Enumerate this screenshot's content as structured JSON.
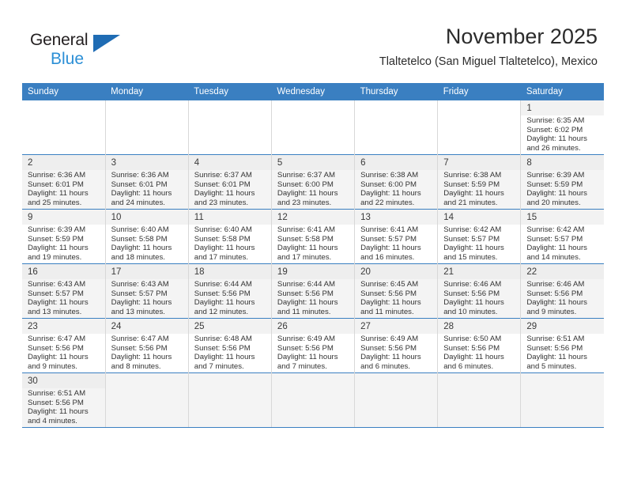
{
  "brand": {
    "name_top": "General",
    "name_bottom": "Blue",
    "triangle_icon": "triangle-icon",
    "accent_color": "#2b8fd6",
    "header_color": "#3a7fc1"
  },
  "header": {
    "title": "November 2025",
    "subtitle": "Tlaltetelco (San Miguel Tlaltetelco), Mexico"
  },
  "calendar": {
    "weekday_headers": [
      "Sunday",
      "Monday",
      "Tuesday",
      "Wednesday",
      "Thursday",
      "Friday",
      "Saturday"
    ],
    "labels": {
      "sunrise": "Sunrise:",
      "sunset": "Sunset:",
      "daylight": "Daylight:"
    },
    "weeks": [
      [
        {
          "day": ""
        },
        {
          "day": ""
        },
        {
          "day": ""
        },
        {
          "day": ""
        },
        {
          "day": ""
        },
        {
          "day": ""
        },
        {
          "day": "1",
          "sunrise": "Sunrise: 6:35 AM",
          "sunset": "Sunset: 6:02 PM",
          "daylight_line1": "Daylight: 11 hours",
          "daylight_line2": "and 26 minutes."
        }
      ],
      [
        {
          "day": "2",
          "sunrise": "Sunrise: 6:36 AM",
          "sunset": "Sunset: 6:01 PM",
          "daylight_line1": "Daylight: 11 hours",
          "daylight_line2": "and 25 minutes."
        },
        {
          "day": "3",
          "sunrise": "Sunrise: 6:36 AM",
          "sunset": "Sunset: 6:01 PM",
          "daylight_line1": "Daylight: 11 hours",
          "daylight_line2": "and 24 minutes."
        },
        {
          "day": "4",
          "sunrise": "Sunrise: 6:37 AM",
          "sunset": "Sunset: 6:01 PM",
          "daylight_line1": "Daylight: 11 hours",
          "daylight_line2": "and 23 minutes."
        },
        {
          "day": "5",
          "sunrise": "Sunrise: 6:37 AM",
          "sunset": "Sunset: 6:00 PM",
          "daylight_line1": "Daylight: 11 hours",
          "daylight_line2": "and 23 minutes."
        },
        {
          "day": "6",
          "sunrise": "Sunrise: 6:38 AM",
          "sunset": "Sunset: 6:00 PM",
          "daylight_line1": "Daylight: 11 hours",
          "daylight_line2": "and 22 minutes."
        },
        {
          "day": "7",
          "sunrise": "Sunrise: 6:38 AM",
          "sunset": "Sunset: 5:59 PM",
          "daylight_line1": "Daylight: 11 hours",
          "daylight_line2": "and 21 minutes."
        },
        {
          "day": "8",
          "sunrise": "Sunrise: 6:39 AM",
          "sunset": "Sunset: 5:59 PM",
          "daylight_line1": "Daylight: 11 hours",
          "daylight_line2": "and 20 minutes."
        }
      ],
      [
        {
          "day": "9",
          "sunrise": "Sunrise: 6:39 AM",
          "sunset": "Sunset: 5:59 PM",
          "daylight_line1": "Daylight: 11 hours",
          "daylight_line2": "and 19 minutes."
        },
        {
          "day": "10",
          "sunrise": "Sunrise: 6:40 AM",
          "sunset": "Sunset: 5:58 PM",
          "daylight_line1": "Daylight: 11 hours",
          "daylight_line2": "and 18 minutes."
        },
        {
          "day": "11",
          "sunrise": "Sunrise: 6:40 AM",
          "sunset": "Sunset: 5:58 PM",
          "daylight_line1": "Daylight: 11 hours",
          "daylight_line2": "and 17 minutes."
        },
        {
          "day": "12",
          "sunrise": "Sunrise: 6:41 AM",
          "sunset": "Sunset: 5:58 PM",
          "daylight_line1": "Daylight: 11 hours",
          "daylight_line2": "and 17 minutes."
        },
        {
          "day": "13",
          "sunrise": "Sunrise: 6:41 AM",
          "sunset": "Sunset: 5:57 PM",
          "daylight_line1": "Daylight: 11 hours",
          "daylight_line2": "and 16 minutes."
        },
        {
          "day": "14",
          "sunrise": "Sunrise: 6:42 AM",
          "sunset": "Sunset: 5:57 PM",
          "daylight_line1": "Daylight: 11 hours",
          "daylight_line2": "and 15 minutes."
        },
        {
          "day": "15",
          "sunrise": "Sunrise: 6:42 AM",
          "sunset": "Sunset: 5:57 PM",
          "daylight_line1": "Daylight: 11 hours",
          "daylight_line2": "and 14 minutes."
        }
      ],
      [
        {
          "day": "16",
          "sunrise": "Sunrise: 6:43 AM",
          "sunset": "Sunset: 5:57 PM",
          "daylight_line1": "Daylight: 11 hours",
          "daylight_line2": "and 13 minutes."
        },
        {
          "day": "17",
          "sunrise": "Sunrise: 6:43 AM",
          "sunset": "Sunset: 5:57 PM",
          "daylight_line1": "Daylight: 11 hours",
          "daylight_line2": "and 13 minutes."
        },
        {
          "day": "18",
          "sunrise": "Sunrise: 6:44 AM",
          "sunset": "Sunset: 5:56 PM",
          "daylight_line1": "Daylight: 11 hours",
          "daylight_line2": "and 12 minutes."
        },
        {
          "day": "19",
          "sunrise": "Sunrise: 6:44 AM",
          "sunset": "Sunset: 5:56 PM",
          "daylight_line1": "Daylight: 11 hours",
          "daylight_line2": "and 11 minutes."
        },
        {
          "day": "20",
          "sunrise": "Sunrise: 6:45 AM",
          "sunset": "Sunset: 5:56 PM",
          "daylight_line1": "Daylight: 11 hours",
          "daylight_line2": "and 11 minutes."
        },
        {
          "day": "21",
          "sunrise": "Sunrise: 6:46 AM",
          "sunset": "Sunset: 5:56 PM",
          "daylight_line1": "Daylight: 11 hours",
          "daylight_line2": "and 10 minutes."
        },
        {
          "day": "22",
          "sunrise": "Sunrise: 6:46 AM",
          "sunset": "Sunset: 5:56 PM",
          "daylight_line1": "Daylight: 11 hours",
          "daylight_line2": "and 9 minutes."
        }
      ],
      [
        {
          "day": "23",
          "sunrise": "Sunrise: 6:47 AM",
          "sunset": "Sunset: 5:56 PM",
          "daylight_line1": "Daylight: 11 hours",
          "daylight_line2": "and 9 minutes."
        },
        {
          "day": "24",
          "sunrise": "Sunrise: 6:47 AM",
          "sunset": "Sunset: 5:56 PM",
          "daylight_line1": "Daylight: 11 hours",
          "daylight_line2": "and 8 minutes."
        },
        {
          "day": "25",
          "sunrise": "Sunrise: 6:48 AM",
          "sunset": "Sunset: 5:56 PM",
          "daylight_line1": "Daylight: 11 hours",
          "daylight_line2": "and 7 minutes."
        },
        {
          "day": "26",
          "sunrise": "Sunrise: 6:49 AM",
          "sunset": "Sunset: 5:56 PM",
          "daylight_line1": "Daylight: 11 hours",
          "daylight_line2": "and 7 minutes."
        },
        {
          "day": "27",
          "sunrise": "Sunrise: 6:49 AM",
          "sunset": "Sunset: 5:56 PM",
          "daylight_line1": "Daylight: 11 hours",
          "daylight_line2": "and 6 minutes."
        },
        {
          "day": "28",
          "sunrise": "Sunrise: 6:50 AM",
          "sunset": "Sunset: 5:56 PM",
          "daylight_line1": "Daylight: 11 hours",
          "daylight_line2": "and 6 minutes."
        },
        {
          "day": "29",
          "sunrise": "Sunrise: 6:51 AM",
          "sunset": "Sunset: 5:56 PM",
          "daylight_line1": "Daylight: 11 hours",
          "daylight_line2": "and 5 minutes."
        }
      ],
      [
        {
          "day": "30",
          "sunrise": "Sunrise: 6:51 AM",
          "sunset": "Sunset: 5:56 PM",
          "daylight_line1": "Daylight: 11 hours",
          "daylight_line2": "and 4 minutes."
        },
        {
          "day": ""
        },
        {
          "day": ""
        },
        {
          "day": ""
        },
        {
          "day": ""
        },
        {
          "day": ""
        },
        {
          "day": ""
        }
      ]
    ]
  }
}
